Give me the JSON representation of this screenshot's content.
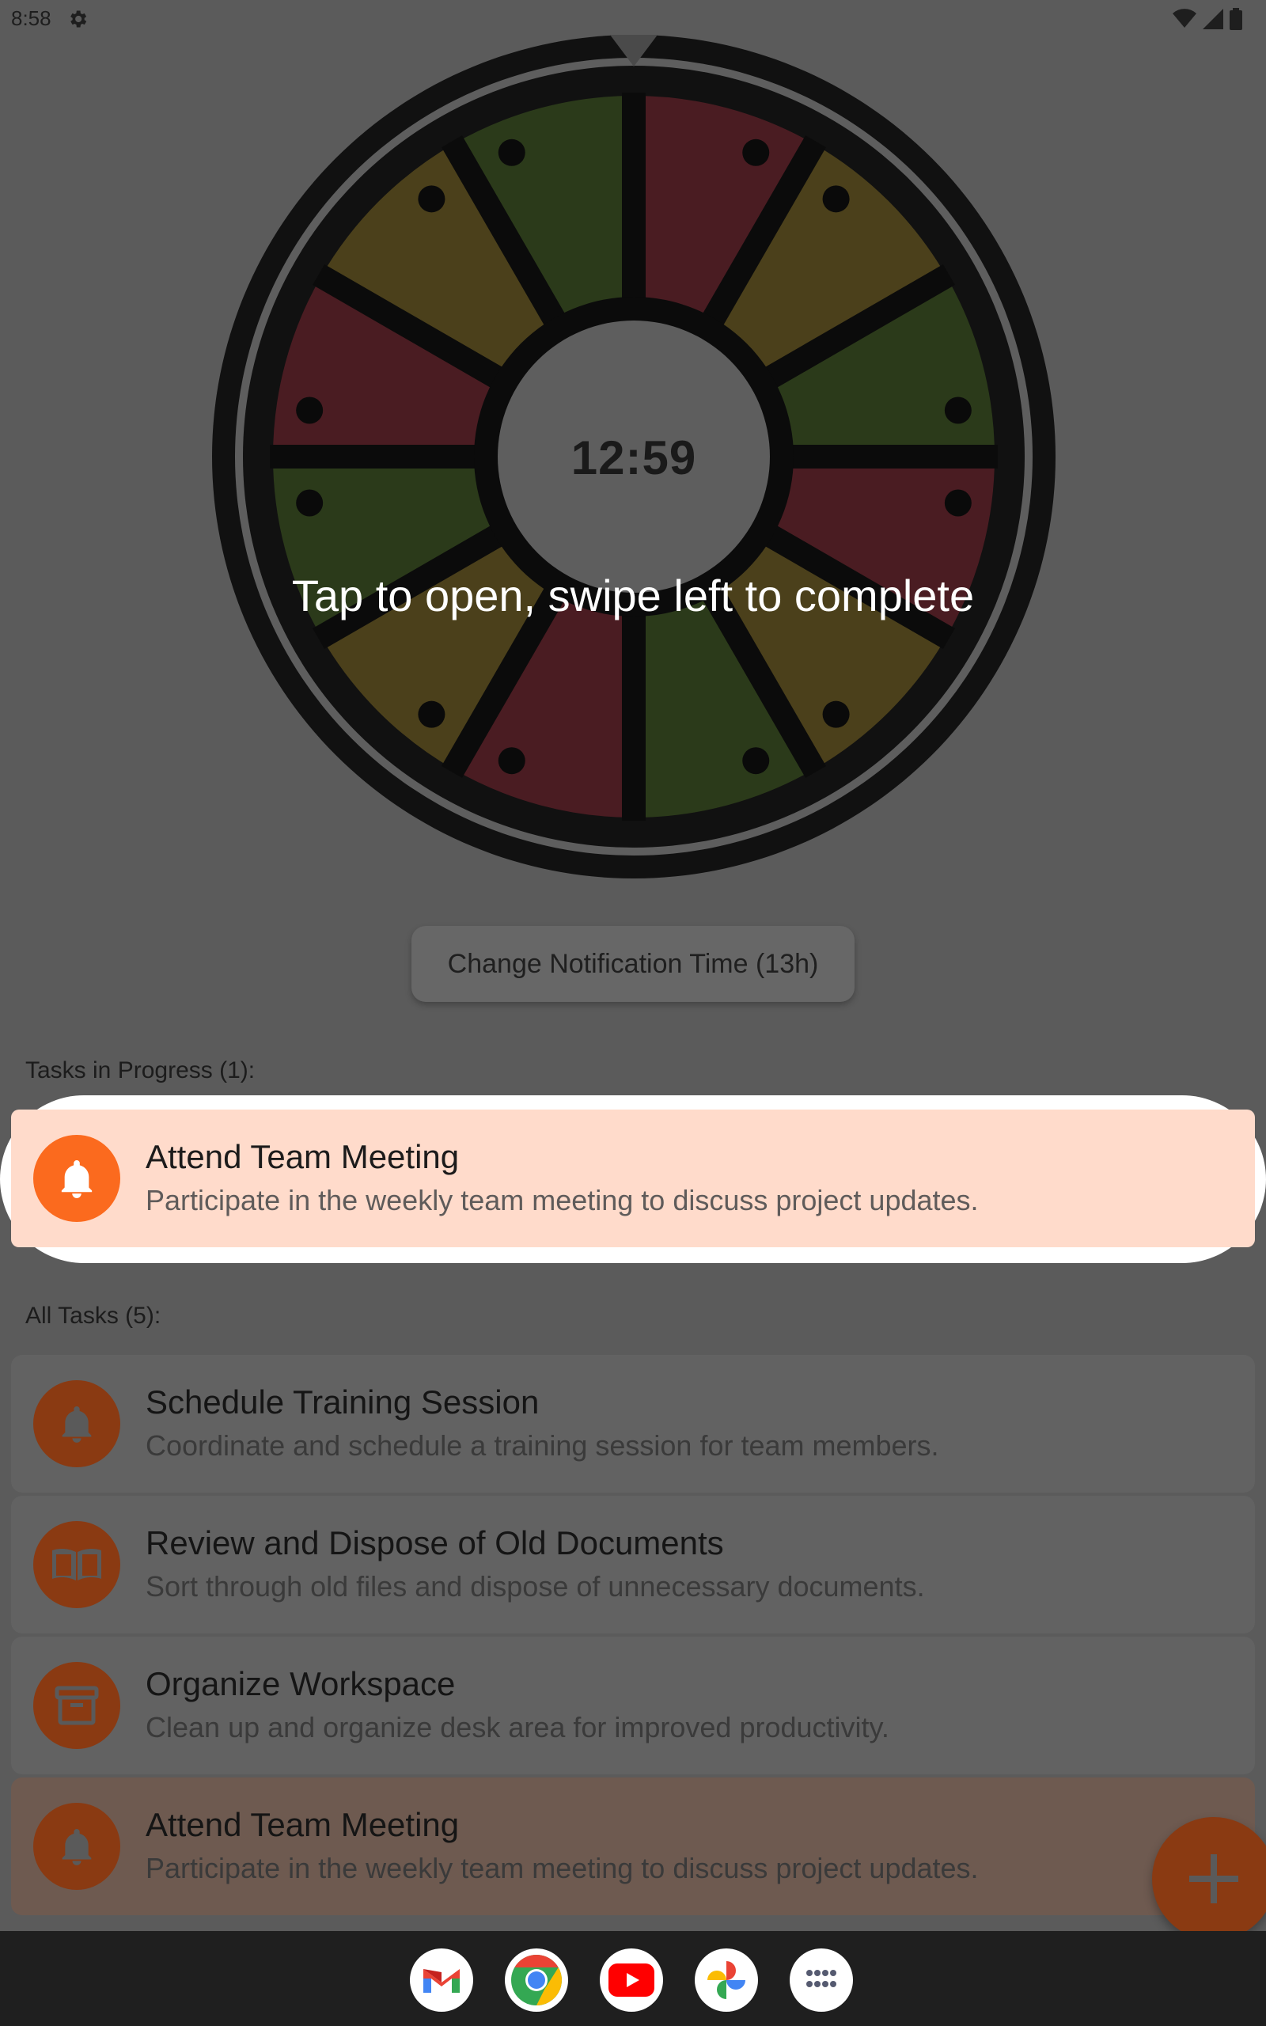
{
  "status_bar": {
    "time": "8:58",
    "icons": [
      "gear-icon",
      "wifi-icon",
      "signal-icon",
      "battery-icon"
    ]
  },
  "wheel": {
    "center_time": "12:59",
    "segment_colors": [
      "#4a1c22",
      "#4b401b",
      "#2b3a1a"
    ]
  },
  "hint": "Tap to open, swipe left to complete",
  "notification_button": {
    "label": "Change Notification Time (13h)"
  },
  "in_progress": {
    "heading": "Tasks in Progress (1):",
    "tasks": [
      {
        "title": "Attend Team Meeting",
        "description": "Participate in the weekly team meeting to discuss project updates.",
        "icon": "bell-icon"
      }
    ]
  },
  "all_tasks": {
    "heading": "All Tasks (5):",
    "tasks": [
      {
        "title": "Schedule Training Session",
        "description": "Coordinate and schedule a training session for team members.",
        "icon": "bell-icon"
      },
      {
        "title": "Review and Dispose of Old Documents",
        "description": "Sort through old files and dispose of unnecessary documents.",
        "icon": "book-icon"
      },
      {
        "title": "Organize Workspace",
        "description": "Clean up and organize desk area for improved productivity.",
        "icon": "box-icon"
      },
      {
        "title": "Attend Team Meeting",
        "description": "Participate in the weekly team meeting to discuss project updates.",
        "icon": "bell-icon"
      }
    ]
  },
  "fab": {
    "icon": "plus-icon"
  },
  "dock": {
    "apps": [
      "gmail-icon",
      "chrome-icon",
      "youtube-icon",
      "photos-icon",
      "app-drawer-icon"
    ]
  },
  "colors": {
    "accent": "#fb6a1e",
    "highlight_card": "#ffdbcb"
  }
}
